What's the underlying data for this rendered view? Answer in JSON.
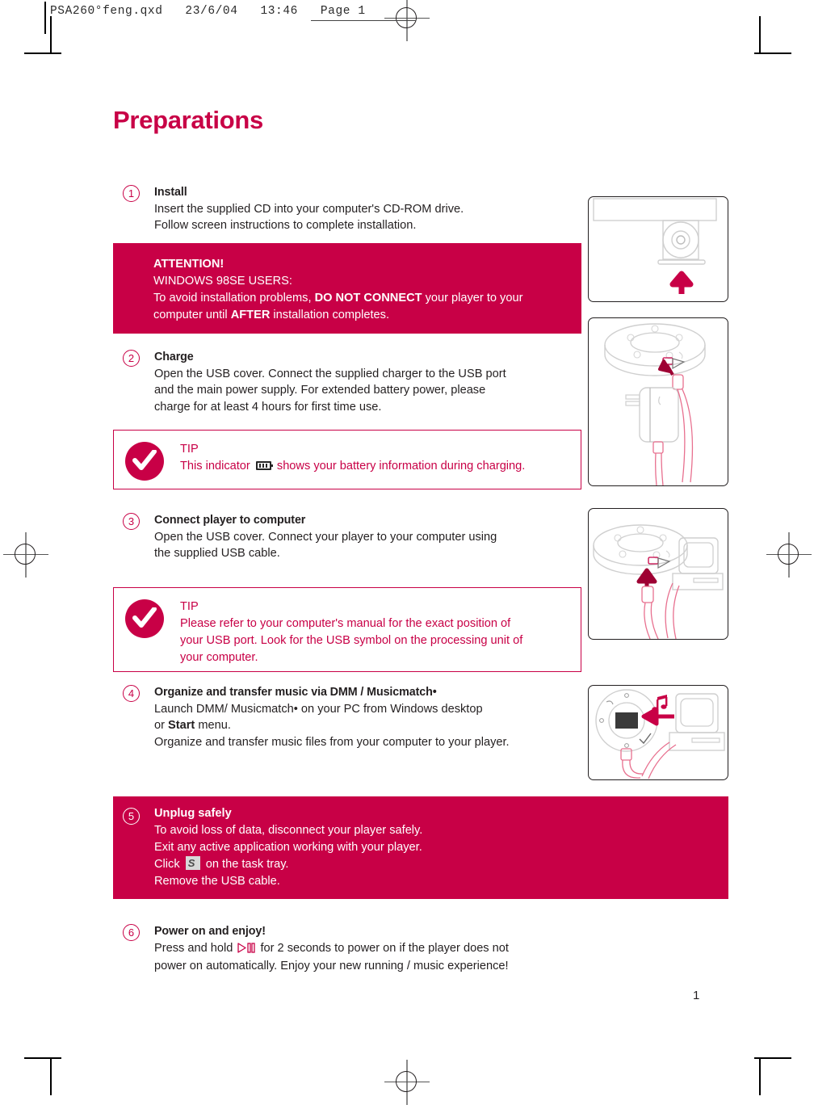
{
  "printer_marks": {
    "file_stamp": "PSA260°feng.qxd   23/6/04   13:46   Page 1",
    "page_number": "1"
  },
  "page": {
    "title": "Preparations",
    "accent_color": "#C80046",
    "text_color": "#231f20"
  },
  "steps": [
    {
      "number": "1",
      "heading": "Install",
      "lines": [
        "Insert the supplied CD into your computer's CD-ROM drive.",
        "Follow screen instructions to complete installation."
      ]
    },
    {
      "number": "2",
      "heading": "Charge",
      "lines": [
        "Open the USB cover.  Connect the supplied charger to the USB port",
        "and the main power supply.  For extended battery power, please",
        "charge for at least 4 hours for first time use."
      ]
    },
    {
      "number": "3",
      "heading": "Connect player to computer",
      "lines": [
        "Open the USB cover.  Connect your player to your computer using",
        "the supplied USB cable."
      ]
    },
    {
      "number": "4",
      "heading": "Organize and transfer music via DMM / Musicmatch•",
      "lines": [
        "Launch DMM/ Musicmatch• on your PC from Windows desktop",
        "or Start menu.",
        "Organize and transfer music files from your computer to your player."
      ],
      "line2_pre": "or ",
      "line2_bold": "Start",
      "line2_post": " menu."
    },
    {
      "number": "6",
      "heading": "Power on and enjoy!",
      "line1_pre": "Press and hold ",
      "line1_post": " for 2 seconds to power on if the player does not",
      "line2": "power on automatically.  Enjoy your new  running / music experience!"
    }
  ],
  "attention": {
    "heading": "ATTENTION!",
    "subheading": "WINDOWS 98SE USERS:",
    "line1_pre": "To avoid installation problems, ",
    "line1_bold": "DO NOT CONNECT",
    "line1_post": " your player to your",
    "line2_pre": "computer until ",
    "line2_bold": "AFTER",
    "line2_post": " installation completes."
  },
  "unplug": {
    "number": "5",
    "heading": "Unplug safely",
    "line1": "To avoid loss of data, disconnect your player safely.",
    "line2": "Exit any active application working with your player.",
    "line3_pre": "Click ",
    "line3_post": " on the task tray.",
    "line4": "Remove the USB cable."
  },
  "tips": [
    {
      "label": "TIP",
      "text_pre": "This indicator ",
      "text_post": " shows your battery information during charging.",
      "icon": "battery-icon"
    },
    {
      "label": "TIP",
      "lines": [
        "Please refer to your computer's manual for the exact position of",
        "your USB port.  Look for the USB symbol on the processing unit of",
        "your computer."
      ]
    }
  ],
  "illustrations": [
    {
      "name": "cd-insert-into-drive"
    },
    {
      "name": "player-with-wall-charger"
    },
    {
      "name": "player-usb-to-computer"
    },
    {
      "name": "music-transfer-to-player"
    }
  ]
}
